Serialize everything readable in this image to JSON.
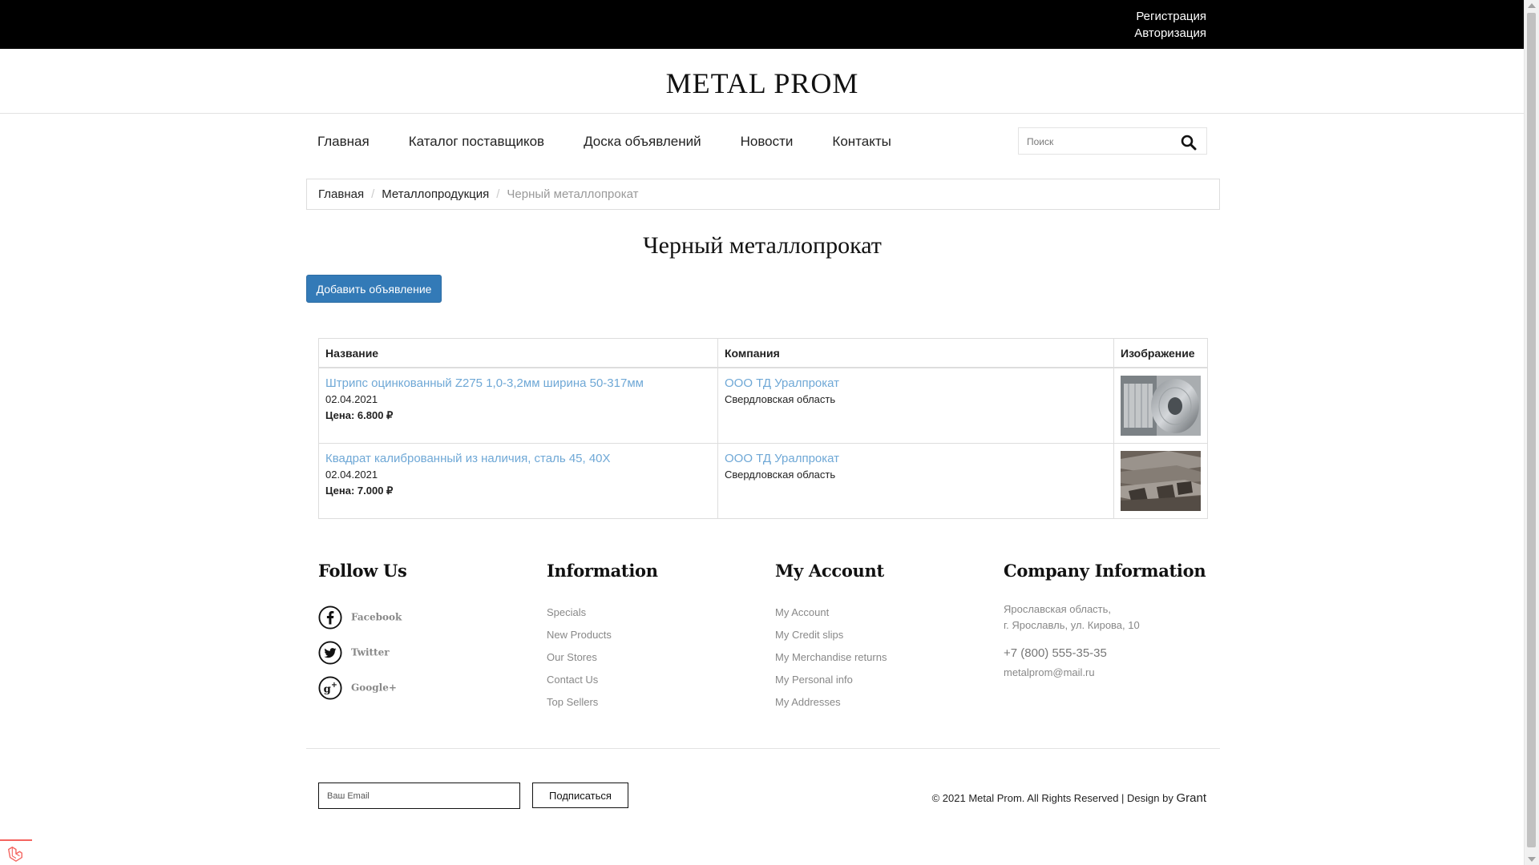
{
  "topbar": {
    "register": "Регистрация",
    "login": "Авторизация"
  },
  "brand": {
    "logo": "METAL PROM"
  },
  "nav": {
    "items": [
      "Главная",
      "Каталог поставщиков",
      "Доска объявлений",
      "Новости",
      "Контакты"
    ],
    "search_placeholder": "Поиск"
  },
  "breadcrumb": {
    "home": "Главная",
    "section": "Металлопродукция",
    "current": "Черный металлопрокат",
    "separator": "/"
  },
  "page": {
    "title": "Черный металлопрокат",
    "add_button": "Добавить объявление"
  },
  "table": {
    "headers": [
      "Название",
      "Компания",
      "Изображение"
    ],
    "rows": [
      {
        "title": "Штрипс оцинкованный Z275 1,0-3,2мм ширина 50-317мм",
        "date": "02.04.2021",
        "price": "Цена: 6.800 ₽",
        "company": "ООО ТД Уралпрокат",
        "region": "Свердловская область",
        "image": "galvanized-coil-photo"
      },
      {
        "title": "Квадрат калиброванный из наличия, сталь 45, 40Х",
        "date": "02.04.2021",
        "price": "Цена: 7.000 ₽",
        "company": "ООО ТД Уралпрокат",
        "region": "Свердловская область",
        "image": "steel-square-bars-photo"
      }
    ]
  },
  "footer": {
    "follow": {
      "title": "Follow Us",
      "links": [
        "Facebook",
        "Twitter",
        "Google+"
      ]
    },
    "information": {
      "title": "Information",
      "links": [
        "Specials",
        "New Products",
        "Our Stores",
        "Contact Us",
        "Top Sellers"
      ]
    },
    "account": {
      "title": "My Account",
      "links": [
        "My Account",
        "My Credit slips",
        "My Merchandise returns",
        "My Personal info",
        "My Addresses"
      ]
    },
    "company": {
      "title": "Company Information",
      "address_line1": "Ярославская область,",
      "address_line2": "г. Ярославль, ул. Кирова, 10",
      "phone": "+7 (800) 555-35-35",
      "email": "metalprom@mail.ru"
    },
    "subscribe": {
      "placeholder": "Ваш Email",
      "button": "Подписаться"
    },
    "copyright": "© 2021 Metal Prom. All Rights Reserved | Design by",
    "designer": "Grant"
  },
  "colors": {
    "link": "#6fa8d6",
    "primary_button": "#337ab7",
    "topbar": "#000000"
  }
}
